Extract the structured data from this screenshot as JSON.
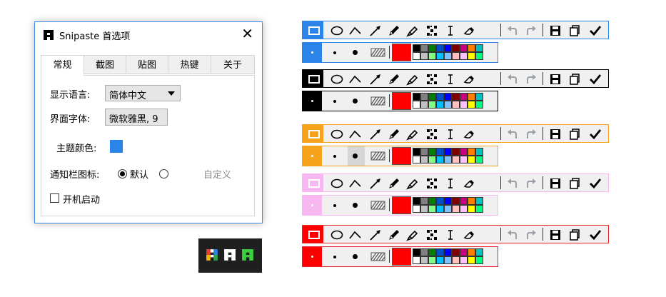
{
  "dialog": {
    "title": "Snipaste 首选项",
    "close_symbol": "✕",
    "tabs": [
      {
        "label": "常规",
        "active": true
      },
      {
        "label": "截图",
        "active": false
      },
      {
        "label": "贴图",
        "active": false
      },
      {
        "label": "热键",
        "active": false
      },
      {
        "label": "关于",
        "active": false
      }
    ],
    "general": {
      "language_label": "显示语言:",
      "language_value": "简体中文",
      "font_label": "界面字体:",
      "font_value": "微软雅黑, 9",
      "theme_label": "主题颜色:",
      "theme_color": "#2b84e8",
      "tray_icon_label": "通知栏图标:",
      "tray_default_label": "默认",
      "tray_default_selected": true,
      "tray_custom_label": "自定义",
      "tray_custom_selected": false,
      "autostart_label": "开机启动",
      "autostart_checked": false
    }
  },
  "tray_icons": [
    {
      "name": "snipaste-multicolor-icon",
      "colors": [
        "#e8412c",
        "#2b84e8",
        "#f7b500",
        "#2ca64a"
      ]
    },
    {
      "name": "snipaste-white-icon",
      "colors": [
        "#ffffff"
      ]
    },
    {
      "name": "snipaste-green-icon",
      "colors": [
        "#3cd040"
      ]
    }
  ],
  "toolbar": {
    "tools": [
      "rectangle-icon",
      "ellipse-icon",
      "polyline-icon",
      "arrow-icon",
      "pencil-icon",
      "marker-icon",
      "mosaic-icon",
      "text-icon",
      "eraser-icon"
    ],
    "history": [
      "undo-icon",
      "redo-icon"
    ],
    "actions": [
      "save-icon",
      "copy-icon",
      "done-icon"
    ],
    "pen_sizes": [
      "small-dot-icon",
      "medium-dot-icon",
      "large-dot-icon",
      "hatch-fill-icon"
    ],
    "current_color": "#ff0000",
    "palette_top": [
      "#000000",
      "#808080",
      "#008000",
      "#0050c8",
      "#0000ff",
      "#800000",
      "#c80080",
      "#ff8000",
      "#00c0c0"
    ],
    "palette_bottom": [
      "#ffffff",
      "#c0c0c0",
      "#80ff80",
      "#00c0ff",
      "#80c0ff",
      "#ffc0c0",
      "#ffc0ff",
      "#ffff00",
      "#00ff80"
    ]
  },
  "toolbar_themes": [
    {
      "name": "blue",
      "accent": "#2b84e8",
      "selection_bg": "#2b84e8",
      "selection_icon": "#ffffff"
    },
    {
      "name": "black",
      "accent": "#000000",
      "selection_bg": "#000000",
      "selection_icon": "#ffffff"
    },
    {
      "name": "orange",
      "accent": "#f7a21b",
      "selection_bg": "#f7a21b",
      "selection_icon": "#ffffff"
    },
    {
      "name": "pink",
      "accent": "#f7b7f0",
      "selection_bg": "#f7b7f0",
      "selection_icon": "#ffffff"
    },
    {
      "name": "red",
      "accent": "#e8242a",
      "selection_bg": "#ff0000",
      "selection_icon": "#ffffff"
    }
  ]
}
